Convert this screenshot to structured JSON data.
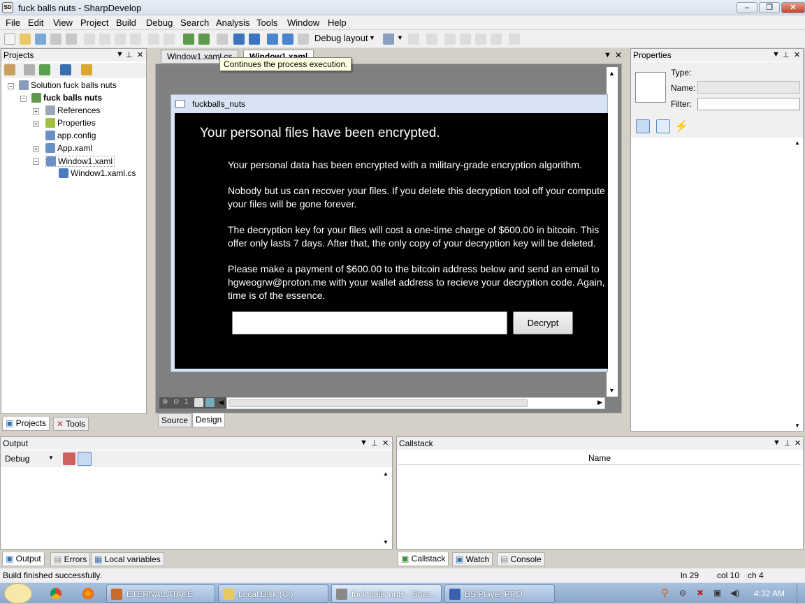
{
  "window": {
    "title": "fuck balls nuts - SharpDevelop",
    "minimize": "–",
    "maximize": "❐",
    "close": "✕"
  },
  "menu": [
    "File",
    "Edit",
    "View",
    "Project",
    "Build",
    "Debug",
    "Search",
    "Analysis",
    "Tools",
    "Window",
    "Help"
  ],
  "toolbar": {
    "debug_layout": "Debug layout",
    "tooltip": "Continues the process execution."
  },
  "projects": {
    "title": "Projects",
    "solution": "Solution fuck balls nuts",
    "project": "fuck balls nuts",
    "items": [
      "References",
      "Properties",
      "app.config",
      "App.xaml",
      "Window1.xaml"
    ],
    "child": "Window1.xaml.cs",
    "tabs": [
      "Projects",
      "Tools"
    ]
  },
  "editor": {
    "tabs": [
      "Window1.xaml.cs",
      "Window1.xaml"
    ],
    "view_tabs": [
      "Source",
      "Design"
    ],
    "zoom": "1"
  },
  "wpf_window": {
    "title": "fuckballs_nuts",
    "heading": "Your personal files have been encrypted.",
    "paragraphs": [
      "Your personal data has been encrypted with a military-grade encryption algorithm.",
      "Nobody but us can recover your files. If you delete this decryption tool off your compute\nyour files will be gone forever.",
      "The decryption key for your files will cost a one-time charge of $600.00 in bitcoin. This\noffer only lasts 7 days. After that, the only copy of your decryption key will be deleted.",
      "Please make a payment of $600.00 to the bitcoin address below and send an email to\nhgweogrw@proton.me with your wallet address to recieve your decryption code. Again,\ntime is of the essence."
    ],
    "button": "Decrypt"
  },
  "properties": {
    "title": "Properties",
    "type_label": "Type:",
    "name_label": "Name:",
    "filter_label": "Filter:"
  },
  "output": {
    "title": "Output",
    "source": "Debug",
    "tabs": [
      "Output",
      "Errors",
      "Local variables"
    ]
  },
  "callstack": {
    "title": "Callstack",
    "column": "Name",
    "tabs": [
      "Callstack",
      "Watch",
      "Console"
    ]
  },
  "status": {
    "message": "Build finished successfully.",
    "ln": "ln 29",
    "col": "col 10",
    "ch": "ch 4"
  },
  "taskbar": {
    "items": [
      "ETERNAL ATAKE",
      "Local Disk (C:)",
      "fuck balls nuts - Shar...",
      "BS.Player PRO"
    ],
    "time": "4:32 AM"
  }
}
